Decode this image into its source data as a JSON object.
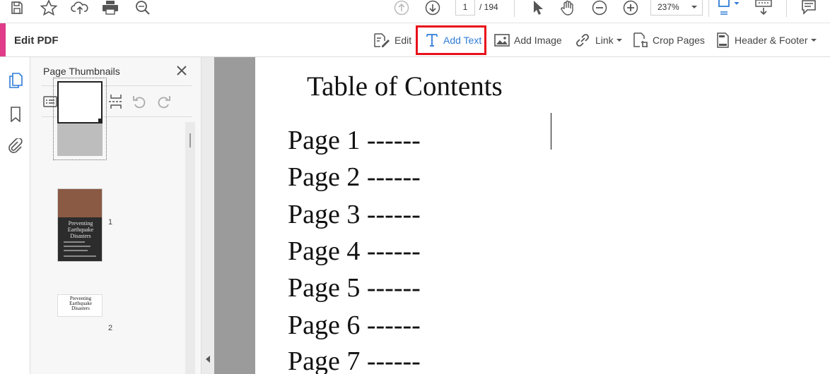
{
  "toolbar": {
    "page_current": "1",
    "page_total": "/ 194",
    "zoom": "237%"
  },
  "edit_bar": {
    "title": "Edit PDF",
    "tools": [
      {
        "label": "Edit",
        "has_menu": false
      },
      {
        "label": "Add Text",
        "has_menu": false,
        "active": true
      },
      {
        "label": "Add Image",
        "has_menu": false
      },
      {
        "label": "Link",
        "has_menu": true
      },
      {
        "label": "Crop Pages",
        "has_menu": false
      },
      {
        "label": "Header & Footer",
        "has_menu": true
      }
    ]
  },
  "thumbnails_panel": {
    "title": "Page Thumbnails",
    "thumbnails": [
      {
        "label": "1"
      },
      {
        "label": "2",
        "cover_text": "Preventing Earthquake Disasters"
      },
      {
        "label": "",
        "cover_text": "Preventing Earthquake Disasters"
      }
    ]
  },
  "document": {
    "title": "Table of Contents",
    "lines": [
      "Page 1 ------",
      "Page 2 ------",
      "Page 3 ------",
      "Page 4 ------",
      "Page 5 ------",
      "Page 6 ------",
      "Page 7 ------"
    ]
  },
  "colors": {
    "accent": "#e03c8a",
    "active_tool": "#2f7bd6",
    "highlight": "#e8101a"
  }
}
